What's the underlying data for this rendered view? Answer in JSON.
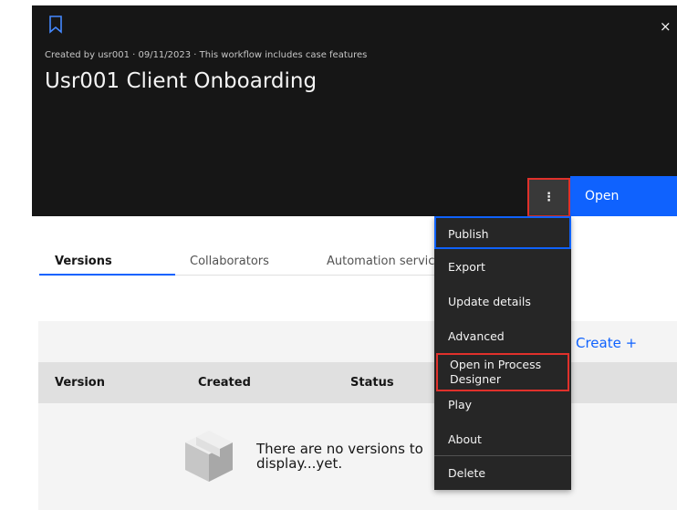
{
  "header": {
    "meta": "Created by usr001 · 09/11/2023 · This workflow includes case features",
    "title": "Usr001 Client Onboarding",
    "close_label": "×",
    "overflow_label": "⋮",
    "open_label": "Open"
  },
  "tabs": [
    {
      "label": "Versions",
      "selected": true
    },
    {
      "label": "Collaborators",
      "selected": false
    },
    {
      "label": "Automation services",
      "selected": false
    }
  ],
  "panel": {
    "create_label": "Create  +",
    "columns": [
      "Version",
      "Created",
      "Status"
    ],
    "empty_text": "There are no versions to display...yet."
  },
  "menu": {
    "items": [
      "Publish",
      "Export",
      "Update details",
      "Advanced",
      "Open in Process Designer",
      "Play",
      "About",
      "Delete"
    ]
  },
  "colors": {
    "accent": "#0f62fe",
    "header_bg": "#161616",
    "menu_bg": "#262626",
    "highlight": "#e0312b"
  },
  "icons": [
    "bookmark-icon",
    "close-icon",
    "overflow-menu-icon",
    "add-icon",
    "empty-box-icon"
  ]
}
